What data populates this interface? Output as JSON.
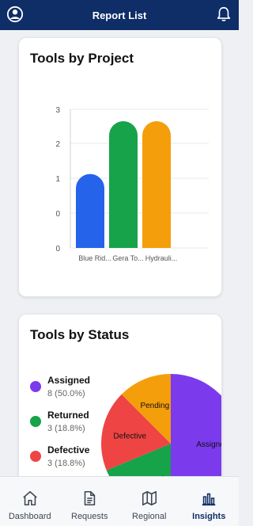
{
  "header": {
    "title": "Report List"
  },
  "cards": {
    "tools_by_project": {
      "title": "Tools by Project"
    },
    "tools_by_status": {
      "title": "Tools by Status"
    }
  },
  "chart_data": [
    {
      "type": "bar",
      "title": "Tools by Project",
      "categories": [
        "Blue Rid...",
        "Gera To...",
        "Hydrauli..."
      ],
      "values": [
        1.75,
        3,
        3
      ],
      "colors": [
        "#2563eb",
        "#16a34a",
        "#f59e0b"
      ],
      "y_ticks": [
        "3",
        "2",
        "1",
        "0",
        "0"
      ],
      "grid": true
    },
    {
      "type": "pie",
      "title": "Tools by Status",
      "slices": [
        {
          "label": "Assigned",
          "value": 8,
          "percent": "8 (50.0%)",
          "color": "#7c3aed"
        },
        {
          "label": "Returned",
          "value": 3,
          "percent": "3 (18.8%)",
          "color": "#16a34a"
        },
        {
          "label": "Defective",
          "value": 3,
          "percent": "3 (18.8%)",
          "color": "#ef4444"
        },
        {
          "label": "Pending",
          "value": 2,
          "color": "#f59e0b"
        }
      ],
      "legend_placement": "left"
    }
  ],
  "legend": [
    {
      "label": "Assigned",
      "value": "8 (50.0%)",
      "color": "#7c3aed"
    },
    {
      "label": "Returned",
      "value": "3 (18.8%)",
      "color": "#16a34a"
    },
    {
      "label": "Defective",
      "value": "3 (18.8%)",
      "color": "#ef4444"
    }
  ],
  "nav": {
    "items": [
      {
        "label": "Dashboard",
        "icon": "home-icon"
      },
      {
        "label": "Requests",
        "icon": "document-icon"
      },
      {
        "label": "Regional",
        "icon": "map-icon"
      },
      {
        "label": "Insights",
        "icon": "bar-chart-icon"
      }
    ],
    "active": "Insights"
  }
}
